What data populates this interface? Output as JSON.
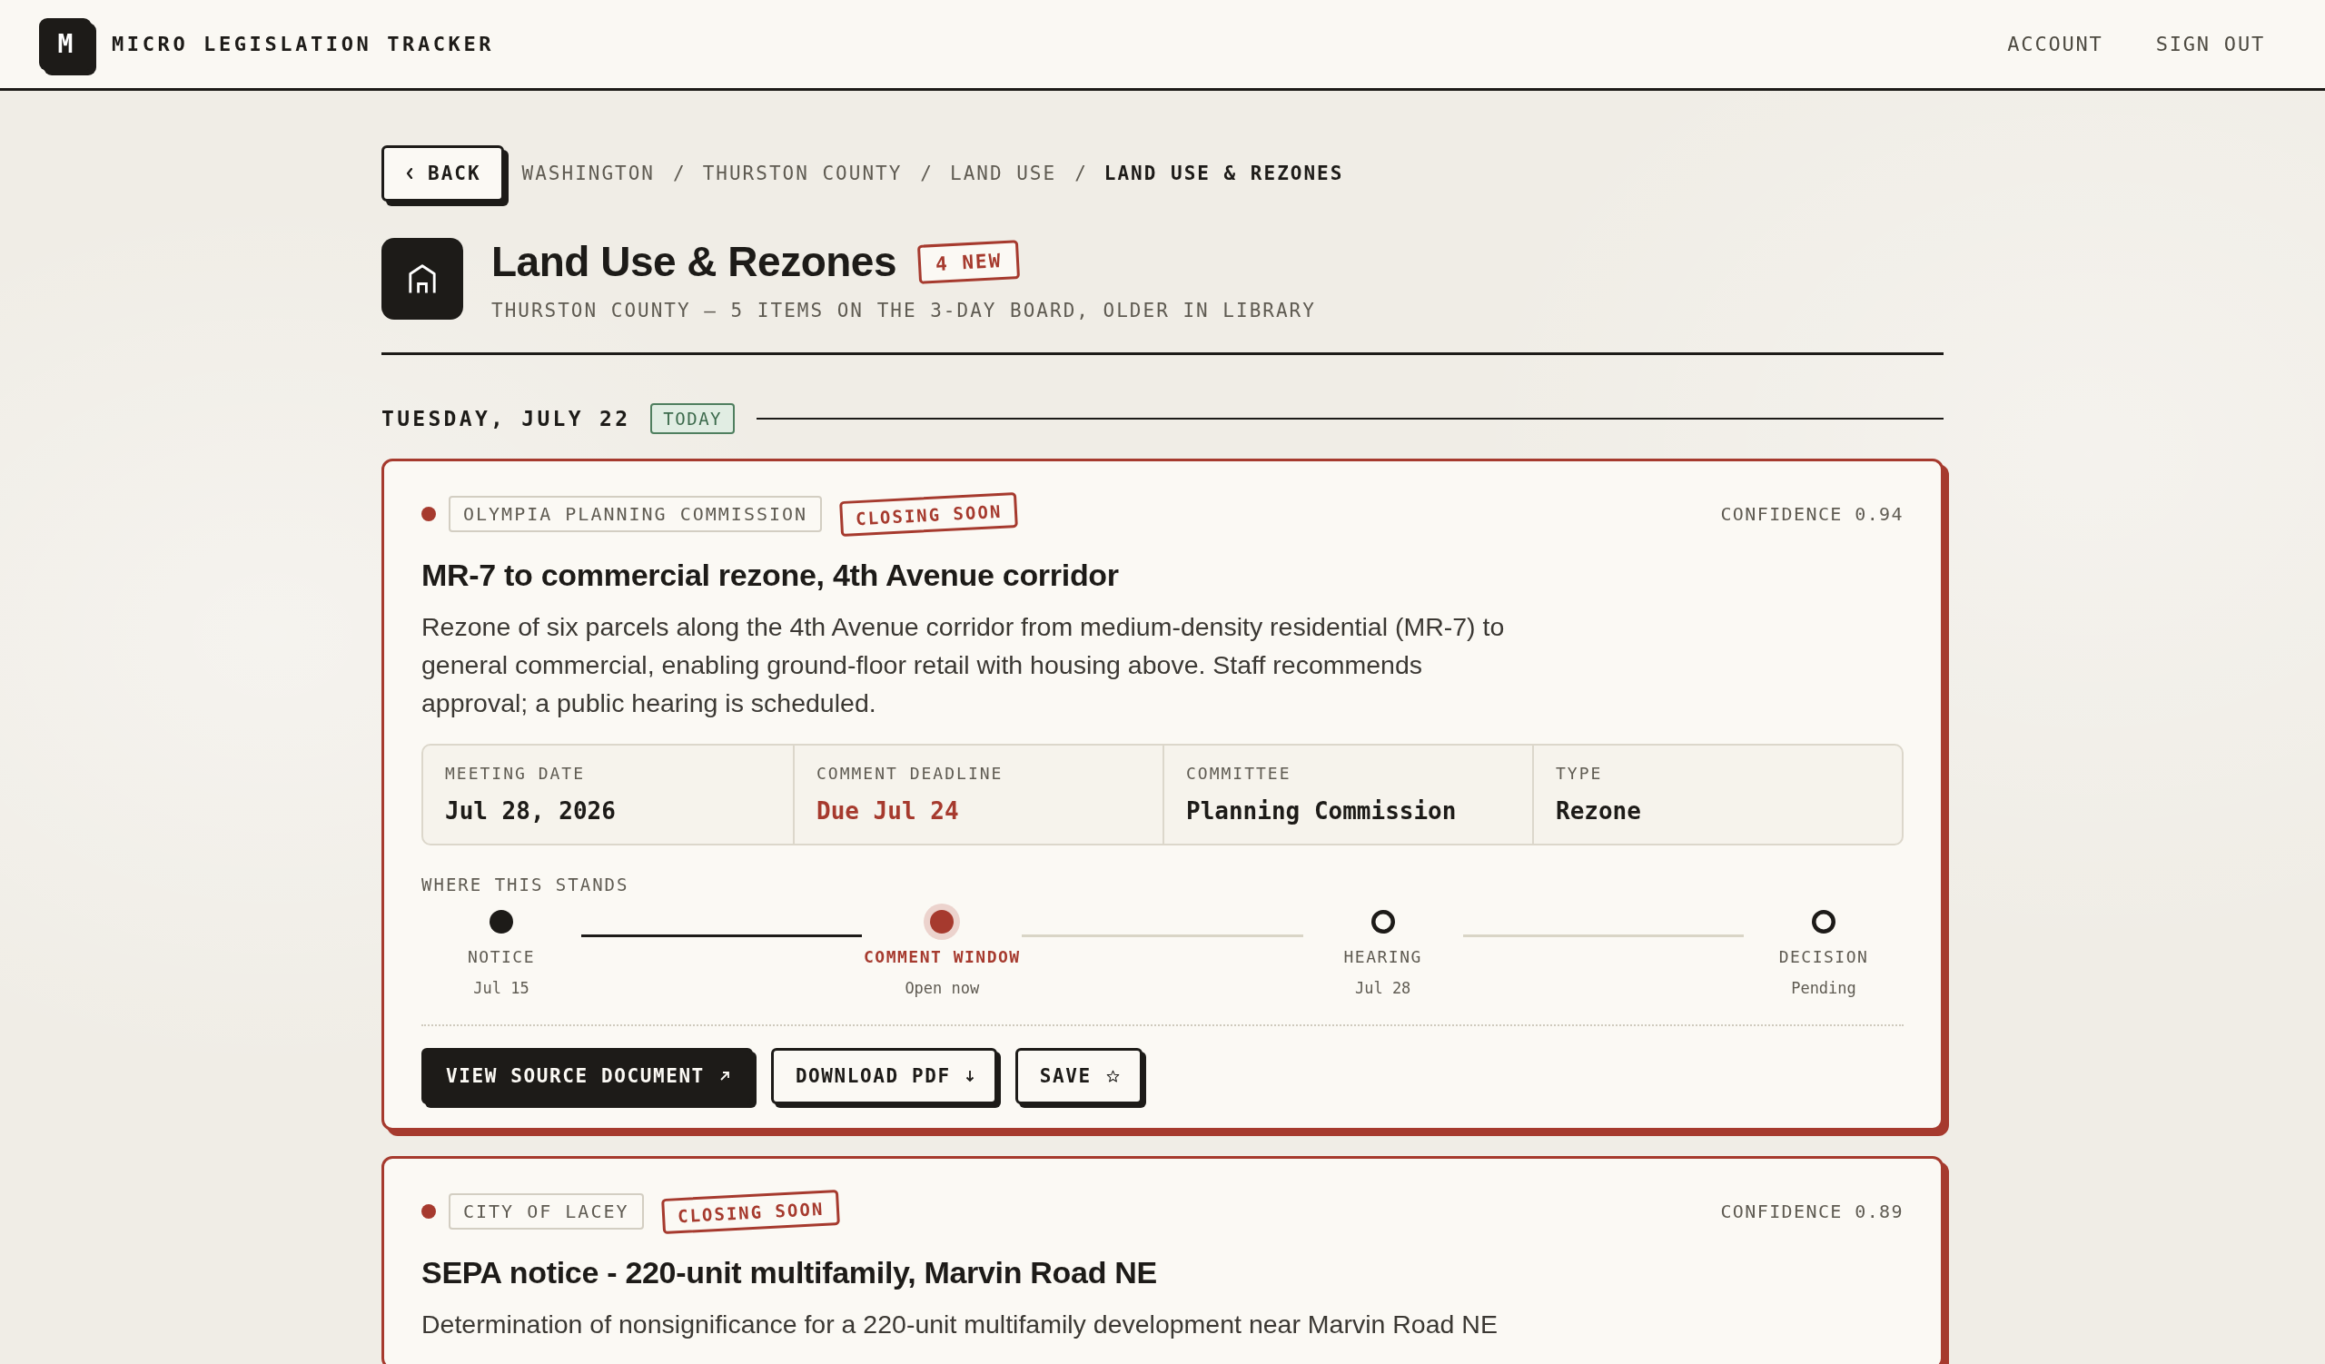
{
  "header": {
    "logo_letter": "M",
    "app_name": "MICRO LEGISLATION TRACKER",
    "nav": [
      "ACCOUNT",
      "SIGN OUT"
    ]
  },
  "breadcrumb": {
    "back_label": "BACK",
    "items": [
      {
        "label": "WASHINGTON",
        "separator": "/",
        "current": false
      },
      {
        "label": "THURSTON COUNTY",
        "separator": "/",
        "current": false
      },
      {
        "label": "LAND USE",
        "separator": "/",
        "current": false
      },
      {
        "label": "LAND USE & REZONES",
        "current": true
      }
    ]
  },
  "category": {
    "title": "Land Use & Rezones",
    "new_badge": "4 NEW",
    "subtitle": "THURSTON COUNTY — 5 ITEMS ON THE 3-DAY BOARD, OLDER IN LIBRARY"
  },
  "day_groups": [
    {
      "date": "TUESDAY, JULY 22",
      "today_badge": "TODAY",
      "items": [
        {
          "color": "#a63a2e",
          "source": "OLYMPIA PLANNING COMMISSION",
          "status": "CLOSING SOON",
          "confidence": "CONFIDENCE 0.94",
          "title": "MR-7 to commercial rezone, 4th Avenue corridor",
          "description": "Rezone of six parcels along the 4th Avenue corridor from medium-density residential (MR-7) to general commercial, enabling ground-floor retail with housing above. Staff recommends approval; a public hearing is scheduled.",
          "details": [
            {
              "label": "MEETING DATE",
              "value": "Jul 28, 2026",
              "urgent": false
            },
            {
              "label": "COMMENT DEADLINE",
              "value": "Due Jul 24",
              "urgent": true
            },
            {
              "label": "COMMITTEE",
              "value": "Planning Commission",
              "urgent": false
            },
            {
              "label": "TYPE",
              "value": "Rezone",
              "urgent": false
            }
          ],
          "progress_label": "WHERE THIS STANDS",
          "stages": [
            {
              "label": "NOTICE",
              "date": "Jul 15",
              "kind": "done"
            },
            {
              "label": "COMMENT WINDOW",
              "date": "Open now",
              "kind": "current"
            },
            {
              "label": "HEARING",
              "date": "Jul 28",
              "kind": "pending"
            },
            {
              "label": "DECISION",
              "date": "Pending",
              "kind": "pending"
            }
          ],
          "actions": [
            {
              "label": "VIEW SOURCE DOCUMENT",
              "kind": "external"
            },
            {
              "label": "DOWNLOAD PDF",
              "kind": "download"
            },
            {
              "label": "SAVE",
              "kind": "save"
            }
          ]
        },
        {
          "color": "#a63a2e",
          "source": "CITY OF LACEY",
          "status": "CLOSING SOON",
          "confidence": "CONFIDENCE 0.89",
          "title": "SEPA notice - 220-unit multifamily, Marvin Road NE",
          "description": "Determination of nonsignificance for a 220-unit multifamily development near Marvin Road NE"
        }
      ]
    }
  ]
}
